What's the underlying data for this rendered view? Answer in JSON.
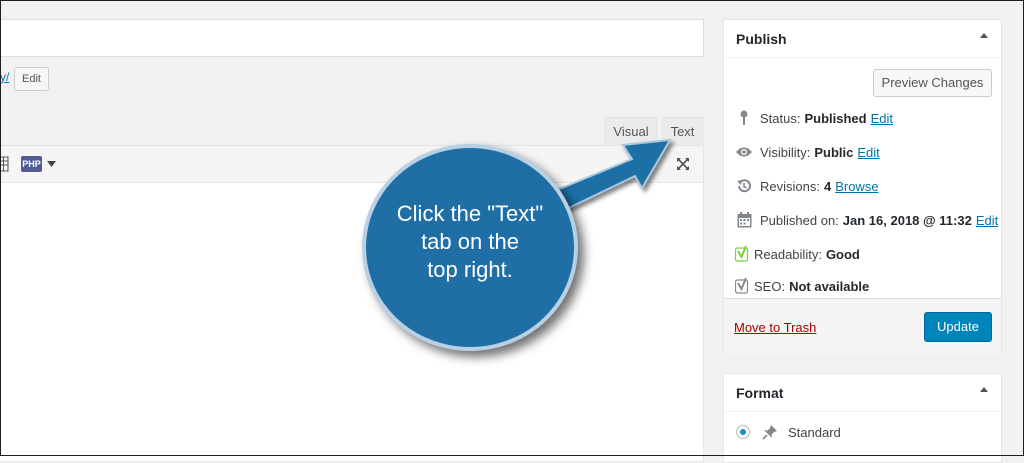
{
  "editor": {
    "permalink_slug": "y/",
    "permalink_edit": "Edit",
    "tabs": {
      "visual": "Visual",
      "text": "Text"
    },
    "toolbar_php": "PHP"
  },
  "publish": {
    "title": "Publish",
    "preview_label": "Preview Changes",
    "status": {
      "label": "Status:",
      "value": "Published",
      "link": "Edit"
    },
    "visibility": {
      "label": "Visibility:",
      "value": "Public",
      "link": "Edit"
    },
    "revisions": {
      "label": "Revisions:",
      "value": "4",
      "link": "Browse"
    },
    "published_on": {
      "label": "Published on:",
      "value": "Jan 16, 2018 @ 11:32",
      "link": "Edit"
    },
    "readability": {
      "label": "Readability:",
      "value": "Good"
    },
    "seo": {
      "label": "SEO:",
      "value": "Not available"
    },
    "trash_label": "Move to Trash",
    "update_label": "Update"
  },
  "format": {
    "title": "Format",
    "options": [
      "Standard"
    ],
    "selected": "Standard"
  },
  "callout": {
    "line1": "Click the \"Text\"",
    "line2": "tab on the",
    "line3": "top right."
  },
  "colors": {
    "accent": "#0085ba",
    "link": "#0073aa",
    "trash": "#a00",
    "callout": "#1f6fa6",
    "yoast_good": "#7ad03a"
  },
  "icons": [
    "pin-icon",
    "eye-icon",
    "revisions-icon",
    "calendar-icon",
    "yoast-icon",
    "pushpin-icon",
    "fullscreen-icon",
    "grid-icon",
    "dropdown-icon"
  ]
}
